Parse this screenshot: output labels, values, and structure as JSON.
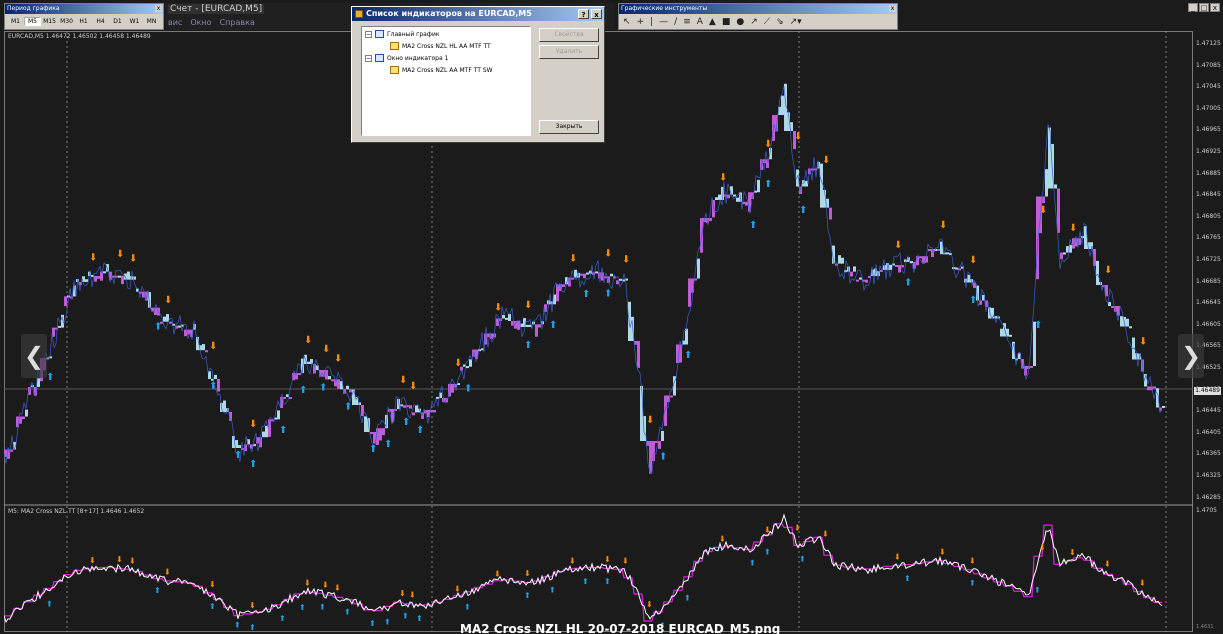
{
  "period_panel": {
    "title": "Период графика",
    "close": "x",
    "timeframes": [
      "M1",
      "M5",
      "M15",
      "M30",
      "H1",
      "H4",
      "D1",
      "W1",
      "MN"
    ],
    "selected": "M5"
  },
  "window": {
    "title": "Счет - [EURCAD,M5]",
    "menu": [
      "вис",
      "Окно",
      "Справка"
    ]
  },
  "tools_panel": {
    "title": "Графические инструменты",
    "close": "x",
    "tools": [
      "↖",
      "+",
      "|",
      "—",
      "/",
      "≡",
      "A",
      "▲",
      "■",
      "●",
      "↗",
      "⟋",
      "⇘",
      "↗▾"
    ]
  },
  "window_controls": [
    "_",
    "□",
    "x"
  ],
  "dialog": {
    "title": "Список индикаторов на EURCAD,M5",
    "help": "?",
    "close": "x",
    "tree": [
      {
        "label": "Главный график",
        "children": [
          "MA2 Cross NZL HL AA MTF TT"
        ]
      },
      {
        "label": "Окно индикатора 1",
        "children": [
          "MA2 Cross NZL AA MTF TT SW"
        ]
      }
    ],
    "buttons": {
      "properties": "Свойства",
      "delete": "Удалить",
      "close": "Закрыть"
    }
  },
  "chart": {
    "symbol_header": "EURCAD,M5  1.46472 1.46502 1.46458 1.46489",
    "indicator_header": "M5: MA2 Cross NZL TT [8+17] 1.4646 1.4652",
    "price_labels": [
      "1.47125",
      "1.47085",
      "1.47045",
      "1.47005",
      "1.46965",
      "1.46925",
      "1.46885",
      "1.46845",
      "1.46805",
      "1.46765",
      "1.46725",
      "1.46685",
      "1.46645",
      "1.46605",
      "1.46565",
      "1.46525",
      "1.46485",
      "1.46445",
      "1.46405",
      "1.46365",
      "1.46325",
      "1.46285"
    ],
    "current_price": "1.46489",
    "subwindow_top": "1.4705",
    "subwindow_bottom": "1.4631",
    "colors": {
      "bull": "#add8e6",
      "bear": "#c05cd8",
      "arrow_up": "#1ea0e6",
      "arrow_down": "#ff8c00",
      "sub_line": "#ffffff",
      "sub_signal": "#dd22dd"
    },
    "nav_left": "❮",
    "nav_right": "❯"
  },
  "chart_data": {
    "type": "line",
    "title": "",
    "xlabel": "",
    "ylabel": "",
    "ylim": [
      1.46285,
      1.47125
    ],
    "grid": false
  },
  "caption": "MA2 Cross NZL HL 20-07-2018 EURCAD_M5.png"
}
